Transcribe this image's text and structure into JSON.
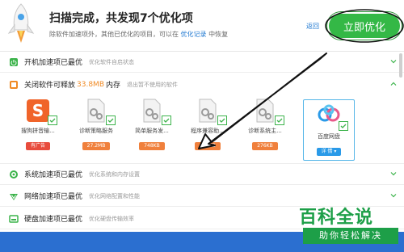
{
  "header": {
    "title": "扫描完成，共发现7个优化项",
    "subtitle_prefix": "除软件加速项外，其他已优化的项目，可以在",
    "subtitle_link": "优化记录",
    "subtitle_suffix": "中恢复",
    "back_label": "返回",
    "optimize_label": "立即优化",
    "accent": "#34b846"
  },
  "sections": [
    {
      "label": "开机加速项已最优",
      "hint": "优化软件自启状态",
      "icon": "power-icon",
      "expanded": false
    },
    {
      "label": "关闭软件可释放",
      "size": "33.8MB",
      "label_suffix": "内存",
      "hint": "退出暂不使用的软件",
      "icon": "memory-icon",
      "expanded": true
    },
    {
      "label": "系统加速项已最优",
      "hint": "优化系统和内存设置",
      "icon": "gear-icon",
      "expanded": false
    },
    {
      "label": "网络加速项已最优",
      "hint": "优化网络配置和性能",
      "icon": "network-icon",
      "expanded": false
    },
    {
      "label": "硬盘加速项已最优",
      "hint": "优化硬盘传输效率",
      "icon": "disk-icon",
      "expanded": false
    }
  ],
  "apps": [
    {
      "name": "搜狗拼音输...",
      "tag": "有广告",
      "icon": "sogou-icon"
    },
    {
      "name": "诊断策略服务",
      "tag": "27.2MB",
      "icon": "service-gear-icon"
    },
    {
      "name": "简单服务发...",
      "tag": "748KB",
      "icon": "service-gear-icon"
    },
    {
      "name": "程序兼容助...",
      "tag": "488KB",
      "icon": "service-gear-icon"
    },
    {
      "name": "诊断系统主...",
      "tag": "276KB",
      "icon": "service-gear-icon"
    },
    {
      "name": "百度网盘",
      "tag": "详 情 ▾",
      "icon": "baidu-netdisk-icon"
    }
  ],
  "watermark": {
    "top": "百科全说",
    "bottom": "助你轻松解决"
  }
}
